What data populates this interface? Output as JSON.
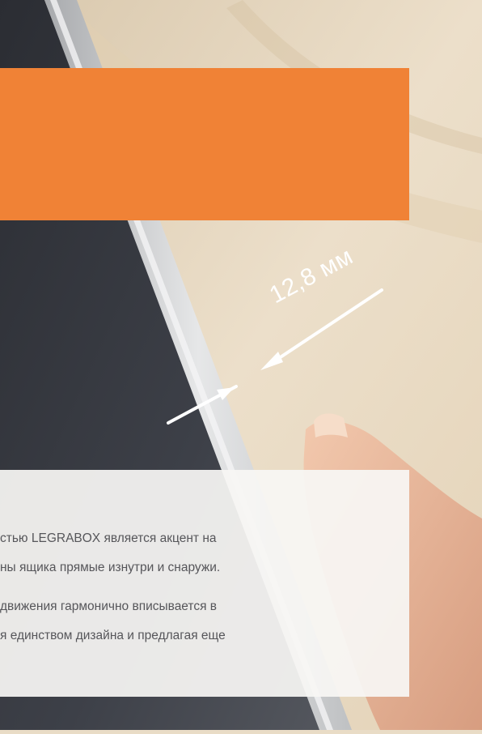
{
  "dimension": {
    "label": "12,8 мм"
  },
  "description": {
    "lines": [
      "стью LEGRABOX является акцент на",
      "ны ящика прямые изнутри и снаружи.",
      "движения гармонично вписывается в",
      "я единством дизайна и предлагая еще"
    ]
  },
  "colors": {
    "accent": "#f08236",
    "panel_bg": "#f7f6f4",
    "body_text": "#56565a"
  }
}
